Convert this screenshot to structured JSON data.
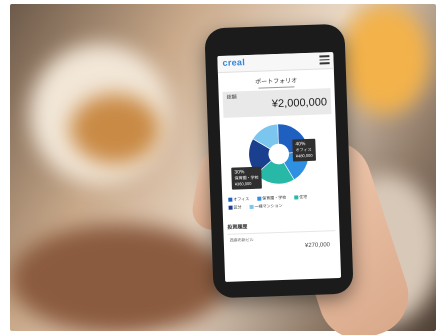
{
  "app": {
    "logo": "creal",
    "menu_icon": "hamburger-icon"
  },
  "page": {
    "title": "ポートフォリオ"
  },
  "summary": {
    "label": "総額",
    "value": "¥2,000,000"
  },
  "chart_data": {
    "type": "pie",
    "categories": [
      "オフィス",
      "保育園・学校",
      "住宅",
      "区分",
      "一棟マンション"
    ],
    "values": [
      24,
      18,
      22,
      20,
      16
    ],
    "colors": [
      "#1f5fbf",
      "#2f8fe0",
      "#28b8a8",
      "#1b3f8f",
      "#7bc6ef"
    ],
    "callouts": [
      {
        "pct": "40%",
        "name": "オフィス",
        "amount": "¥480,000"
      },
      {
        "pct": "30%",
        "name": "保育園・学校",
        "amount": "¥360,000"
      }
    ]
  },
  "section": {
    "title": "投資履歴"
  },
  "history": [
    {
      "name": "西麻布新ビル",
      "amount": "¥270,000"
    }
  ]
}
